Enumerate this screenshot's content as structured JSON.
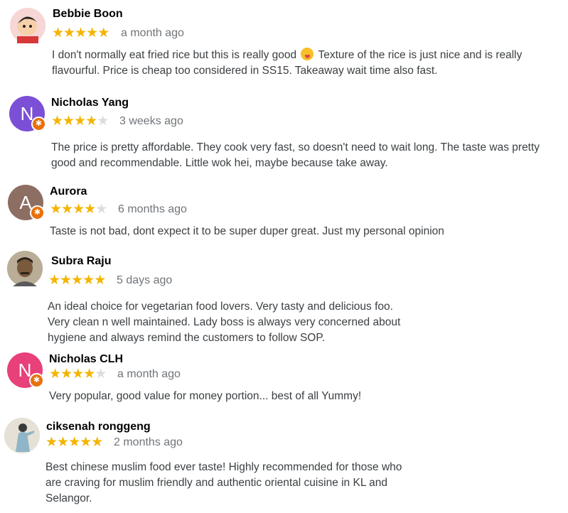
{
  "reviews": [
    {
      "name": "Bebbie Boon",
      "rating": 5,
      "time": "a month ago",
      "avatar_color": "#f3c9c9",
      "avatar_letter": "",
      "text_lines": [
        "I don't normally eat fried rice but this is really good",
        "flavourful. Price is cheap too considered in SS15. Takeaway wait time also fast."
      ],
      "text_after_emoji": "Texture of the rice is just nice and is really"
    },
    {
      "name": "Nicholas Yang",
      "rating": 4,
      "time": "3 weeks ago",
      "avatar_color": "#7b4fd6",
      "avatar_letter": "N",
      "text_lines": [
        "The price is pretty affordable. They cook very fast, so doesn't need to wait long. The taste was pretty",
        "good and recommendable. Little wok hei, maybe because take away."
      ]
    },
    {
      "name": "Aurora",
      "rating": 4,
      "time": "6 months ago",
      "avatar_color": "#8d6e63",
      "avatar_letter": "A",
      "text_lines": [
        "Taste is not bad, dont expect it to be super duper great. Just my personal opinion"
      ]
    },
    {
      "name": "Subra Raju",
      "rating": 5,
      "time": "5 days ago",
      "avatar_color": "#8a7a66",
      "avatar_letter": "",
      "text_lines": [
        "An ideal choice for vegetarian food lovers. Very tasty and delicious foo.",
        "Very clean n well maintained. Lady boss is always very concerned about",
        "hygiene and always remind the customers to follow SOP."
      ]
    },
    {
      "name": "Nicholas CLH",
      "rating": 4,
      "time": "a month ago",
      "avatar_color": "#e8407a",
      "avatar_letter": "N",
      "text_lines": [
        "Very popular, good value for money portion... best of all Yummy!"
      ]
    },
    {
      "name": "ciksenah ronggeng",
      "rating": 5,
      "time": "2 months ago",
      "avatar_color": "#d9d4c8",
      "avatar_letter": "",
      "text_lines": [
        "Best chinese muslim food ever taste! Highly recommended for those who",
        "are craving for muslim friendly and authentic oriental cuisine in KL and",
        "Selangor."
      ]
    }
  ],
  "icons": {
    "star": "star-icon",
    "badge": "local-guide-badge-icon",
    "emoji": "face-savoring-food-emoji"
  },
  "colors": {
    "star_on": "#f4b400",
    "star_off": "#dadce0",
    "badge": "#e8710a"
  }
}
